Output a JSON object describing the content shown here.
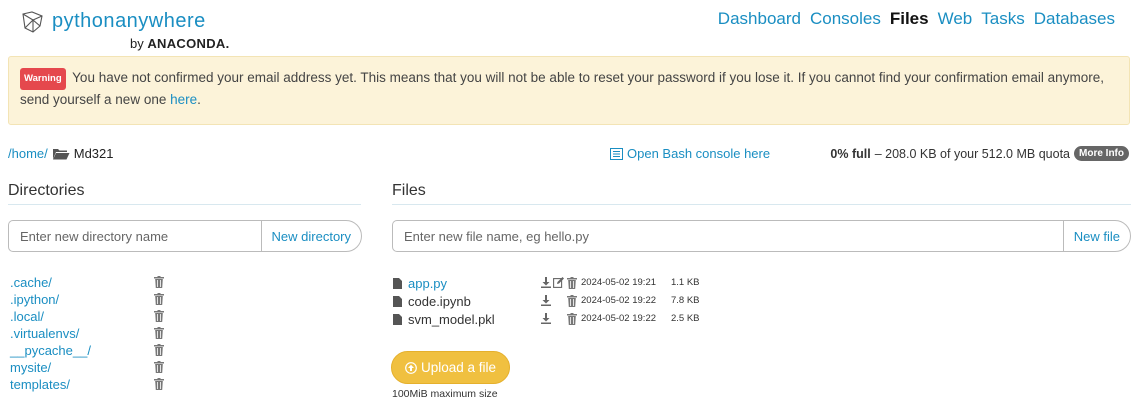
{
  "brand": {
    "name_part1": "python",
    "name_part2": "anywhere",
    "by": "by",
    "company": "ANACONDA.",
    "logo_icon": "pythonanywhere-logo-icon"
  },
  "nav": {
    "items": [
      {
        "label": "Dashboard",
        "active": false
      },
      {
        "label": "Consoles",
        "active": false
      },
      {
        "label": "Files",
        "active": true
      },
      {
        "label": "Web",
        "active": false
      },
      {
        "label": "Tasks",
        "active": false
      },
      {
        "label": "Databases",
        "active": false
      }
    ]
  },
  "warning": {
    "badge": "Warning",
    "text": "You have not confirmed your email address yet. This means that you will not be able to reset your password if you lose it. If you cannot find your confirmation email anymore, send yourself a new one",
    "link": "here",
    "end": "."
  },
  "path": {
    "root": "/home/",
    "current": "Md321",
    "folder_icon": "folder-open-icon"
  },
  "console_link": {
    "label": "Open Bash console here",
    "icon": "console-icon"
  },
  "quota": {
    "percent": "0% full",
    "detail": "– 208.0 KB of your 512.0 MB quota",
    "more_info": "More Info"
  },
  "directories": {
    "heading": "Directories",
    "placeholder": "Enter new directory name",
    "button": "New directory",
    "items": [
      ".cache/",
      ".ipython/",
      ".local/",
      ".virtualenvs/",
      "__pycache__/",
      "mysite/",
      "templates/"
    ]
  },
  "files": {
    "heading": "Files",
    "placeholder": "Enter new file name, eg hello.py",
    "button": "New file",
    "items": [
      {
        "name": "app.py",
        "date": "2024-05-02 19:21",
        "size": "1.1 KB",
        "editable": true
      },
      {
        "name": "code.ipynb",
        "date": "2024-05-02 19:22",
        "size": "7.8 KB",
        "editable": false
      },
      {
        "name": "svm_model.pkl",
        "date": "2024-05-02 19:22",
        "size": "2.5 KB",
        "editable": false
      }
    ],
    "upload_label": "Upload a file",
    "upload_note": "100MiB maximum size"
  },
  "colors": {
    "accent": "#1a8ec2",
    "warning_bg": "#fcf3d9",
    "badge_red": "#e5484d",
    "upload_yellow": "#f0c040"
  }
}
